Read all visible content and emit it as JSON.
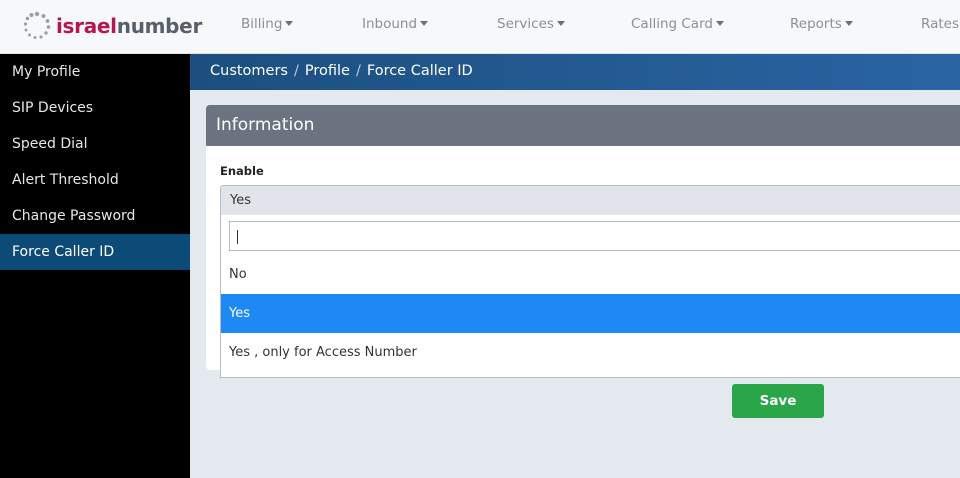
{
  "brand": {
    "name_part1": "israel",
    "name_part2": "number"
  },
  "nav": [
    {
      "label": "Billing"
    },
    {
      "label": "Inbound"
    },
    {
      "label": "Services"
    },
    {
      "label": "Calling Card"
    },
    {
      "label": "Reports"
    },
    {
      "label": "Rates"
    }
  ],
  "sidebar": {
    "items": [
      {
        "label": "My Profile"
      },
      {
        "label": "SIP Devices"
      },
      {
        "label": "Speed Dial"
      },
      {
        "label": "Alert Threshold"
      },
      {
        "label": "Change Password"
      },
      {
        "label": "Force Caller ID",
        "active": true
      }
    ]
  },
  "breadcrumb": {
    "items": [
      "Customers",
      "Profile",
      "Force Caller ID"
    ],
    "separator": "/"
  },
  "card": {
    "title": "Information",
    "enable_label": "Enable",
    "enable_value": "Yes"
  },
  "dropdown": {
    "search_value": "",
    "options": [
      {
        "label": "No"
      },
      {
        "label": "Yes",
        "selected": true
      },
      {
        "label": "Yes , only for Access Number"
      }
    ]
  },
  "actions": {
    "save_label": "Save"
  },
  "colors": {
    "brand_primary": "#b4164f",
    "sidebar_active": "#0c4a77",
    "breadcrumb_bg": "#2a64a3",
    "option_selected": "#1e88f5",
    "save_button": "#2aa548"
  }
}
